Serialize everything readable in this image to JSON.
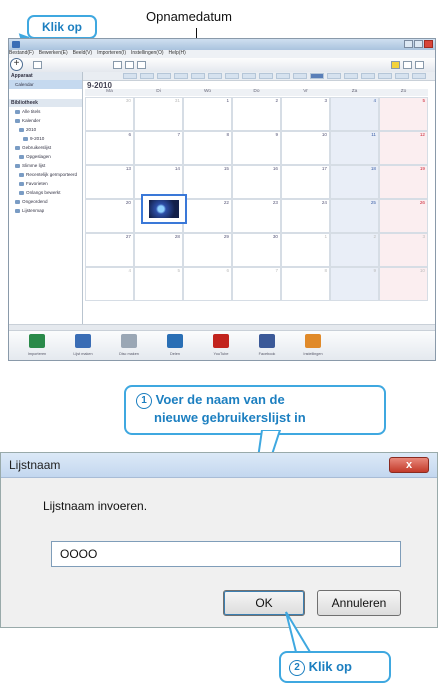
{
  "callouts": {
    "klik_op_top": "Klik op",
    "opnamedatum": "Opnamedatum",
    "step1_number": "1",
    "step1_line1": "Voer de naam van de",
    "step1_line2": "nieuwe gebruikerslijst in",
    "step2_number": "2",
    "step2_text": "Klik op"
  },
  "app": {
    "menu": [
      "Bestand(F)",
      "Bewerken(E)",
      "Beeld(V)",
      "Importeren(I)",
      "Instellingen(O)",
      "Help(H)"
    ],
    "sidebar": {
      "section1": "Apparaat",
      "section2": "Bibliotheek",
      "items": [
        "Calendar",
        "Alle titels",
        "Kalender",
        "2010",
        "9-2010",
        "Gebruikerslijst",
        "Opgeslagen",
        "Slimme lijst",
        "Recentelijk geïmporteerd",
        "Favorieten",
        "Onlangs bewerkt",
        "Ongeordend",
        "Lijstenmap"
      ]
    },
    "calendar": {
      "month": "9-2010",
      "days": [
        "Ma",
        "Di",
        "Wo",
        "Do",
        "Vr",
        "Za",
        "Zo"
      ],
      "weeks": [
        [
          "30",
          "31",
          "1",
          "2",
          "3",
          "4",
          "5"
        ],
        [
          "6",
          "7",
          "8",
          "9",
          "10",
          "11",
          "12"
        ],
        [
          "13",
          "14",
          "15",
          "16",
          "17",
          "18",
          "19"
        ],
        [
          "20",
          "21",
          "22",
          "23",
          "24",
          "25",
          "26"
        ],
        [
          "27",
          "28",
          "29",
          "30",
          "1",
          "2",
          "3"
        ],
        [
          "4",
          "5",
          "6",
          "7",
          "8",
          "9",
          "10"
        ]
      ]
    },
    "bottom_buttons": [
      "Importeren",
      "Lijst maken",
      "Disc maken",
      "Delen",
      "YouTube",
      "Facebook",
      "Instellingen"
    ]
  },
  "dialog": {
    "title": "Lijstnaam",
    "close": "x",
    "prompt": "Lijstnaam invoeren.",
    "input_value": "OOOO",
    "ok_label": "OK",
    "cancel_label": "Annuleren"
  },
  "colors": {
    "callout_blue": "#1c7fc0",
    "callout_border": "#3fa8e0",
    "close_red": "#c33a2a"
  }
}
